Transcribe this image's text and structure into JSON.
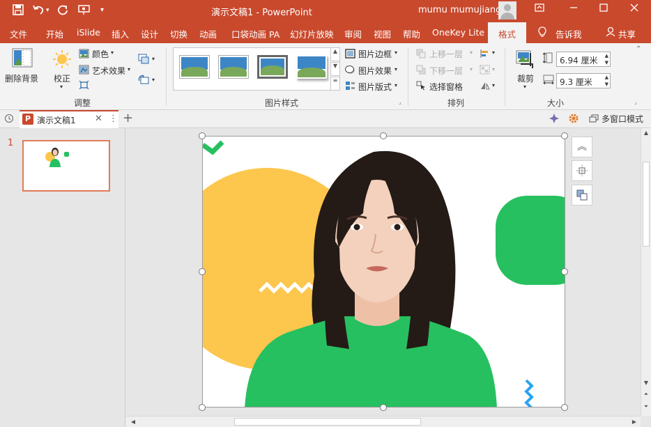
{
  "titlebar": {
    "title": "演示文稿1  -  PowerPoint",
    "user": "mumu mumujiang",
    "save_icon": "save-icon",
    "undo_icon": "undo-icon",
    "redo_icon": "redo-icon",
    "present_icon": "present-icon",
    "customize_label": "▾"
  },
  "tabs": [
    {
      "label": "文件"
    },
    {
      "label": "开始"
    },
    {
      "label": "iSlide"
    },
    {
      "label": "插入"
    },
    {
      "label": "设计"
    },
    {
      "label": "切换"
    },
    {
      "label": "动画"
    },
    {
      "label": "口袋动画 PA"
    },
    {
      "label": "幻灯片放映"
    },
    {
      "label": "审阅"
    },
    {
      "label": "视图"
    },
    {
      "label": "帮助"
    },
    {
      "label": "OneKey Lite"
    },
    {
      "label": "格式"
    },
    {
      "label": "告诉我"
    },
    {
      "label": "共享"
    }
  ],
  "ribbon": {
    "remove_bg": "删除背景",
    "correct": "校正",
    "color": "颜色",
    "art_effects": "艺术效果",
    "adjust_group": "调整",
    "picture_border": "图片边框",
    "picture_effects": "图片效果",
    "picture_layout": "图片版式",
    "styles_group": "图片样式",
    "bring_forward": "上移一层",
    "send_backward": "下移一层",
    "selection_pane": "选择窗格",
    "arrange_group": "排列",
    "crop": "裁剪",
    "height": "6.94 厘米",
    "width": "9.3 厘米",
    "size_group": "大小"
  },
  "docbar": {
    "doc_tab": "演示文稿1",
    "add_tab": "+",
    "multi_window": "多窗口模式"
  },
  "slides": {
    "number": "1"
  },
  "colors": {
    "accent": "#c9492d",
    "yellow": "#fdc64d",
    "green": "#27c060",
    "blue": "#2aa3ef"
  }
}
